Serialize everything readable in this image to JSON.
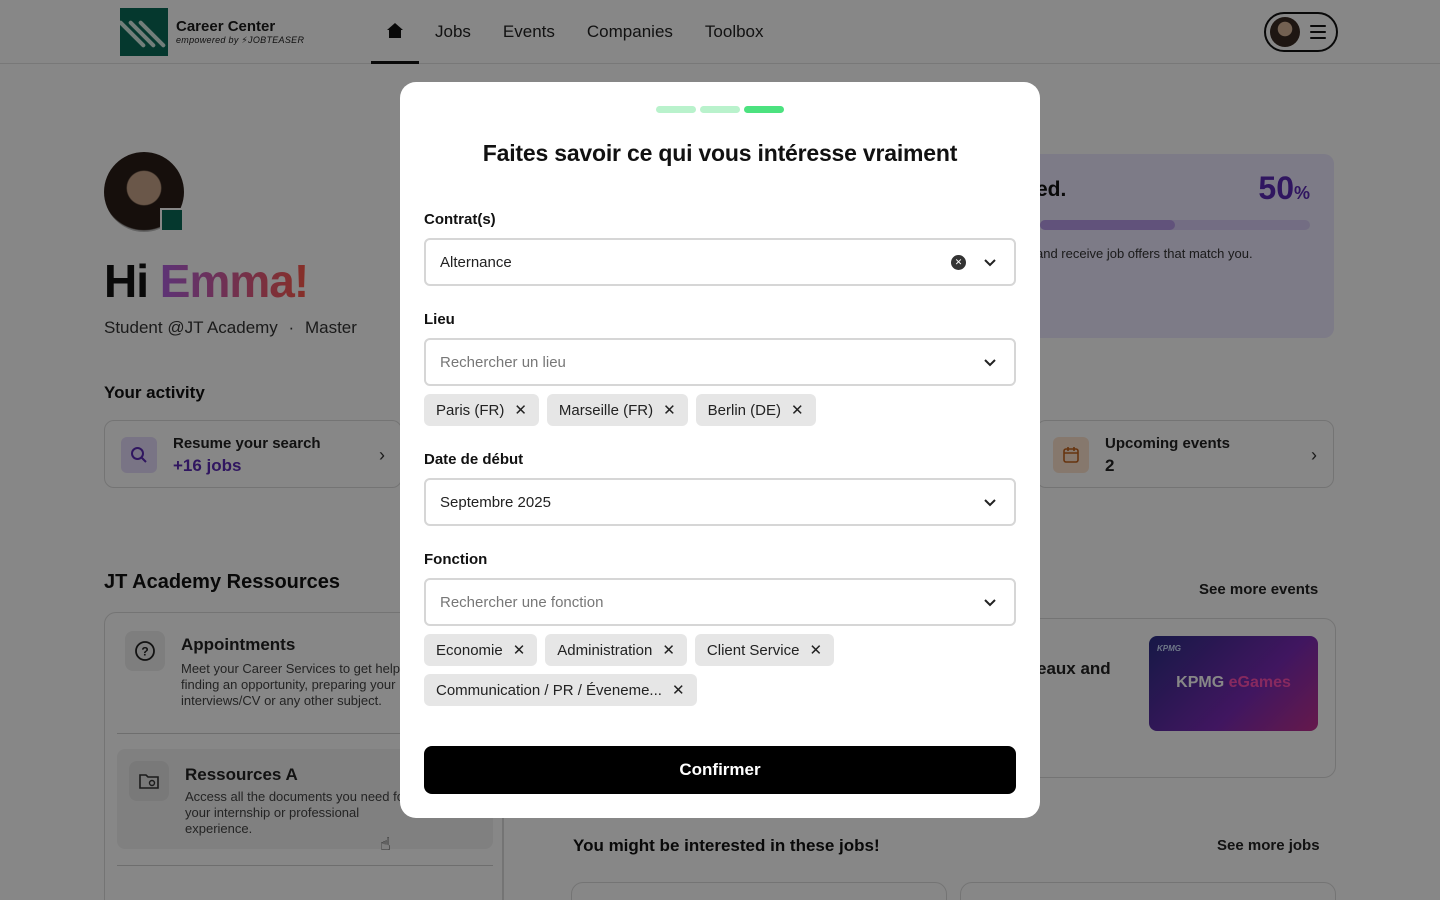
{
  "header": {
    "logo_title": "Career Center",
    "logo_sub": "empowered by ⚡JOBTEASER",
    "nav": [
      "Jobs",
      "Events",
      "Companies",
      "Toolbox"
    ]
  },
  "profile": {
    "greeting_hi": "Hi",
    "greeting_name": "Emma!",
    "school": "Student @JT Academy",
    "separator": "·",
    "level": "Master"
  },
  "activity": {
    "title": "Your activity",
    "resume_title": "Resume your search",
    "resume_value": "+16 jobs",
    "events_title": "Upcoming events",
    "events_value": "2"
  },
  "progress_card": {
    "heading_tail": "ed.",
    "percent": "50",
    "percent_sign": "%",
    "percent_value": 0.5,
    "text": "and receive job offers that match you."
  },
  "resources": {
    "title": "JT Academy Ressources",
    "items": [
      {
        "title": "Appointments",
        "desc": "Meet your Career Services to get help finding an opportunity, preparing your interviews/CV or any other subject."
      },
      {
        "title": "Ressources A",
        "desc": "Access all the documents you need for your internship or professional experience."
      }
    ]
  },
  "events_section": {
    "see_more": "See more events",
    "event_title_fragment": "eaux and",
    "thumb_brand": "KPMG",
    "thumb_title_a": "KPMG ",
    "thumb_title_b": "eGames"
  },
  "jobs_section": {
    "title": "You might be interested in these jobs!",
    "see_more": "See more jobs"
  },
  "modal": {
    "title": "Faites savoir ce qui vous intéresse vraiment",
    "steps_total": 3,
    "steps_active": 3,
    "contract": {
      "label": "Contrat(s)",
      "value": "Alternance"
    },
    "location": {
      "label": "Lieu",
      "placeholder": "Rechercher un lieu",
      "chips": [
        "Paris (FR)",
        "Marseille (FR)",
        "Berlin (DE)"
      ]
    },
    "start_date": {
      "label": "Date de début",
      "value": "Septembre 2025"
    },
    "function": {
      "label": "Fonction",
      "placeholder": "Rechercher une fonction",
      "chips": [
        "Economie",
        "Administration",
        "Client Service",
        "Communication / PR / Éveneme..."
      ]
    },
    "confirm_label": "Confirmer"
  },
  "icons": {
    "home": "home-icon",
    "menu": "hamburger-icon",
    "search": "search-icon",
    "calendar": "calendar-icon",
    "chevron": "chevron-down-icon",
    "clear": "clear-circle-icon",
    "remove": "close-icon"
  },
  "colors": {
    "brand_green": "#0b6b57",
    "step_active": "#4ce27f",
    "step_inactive": "#b9f2cc",
    "accent_purple": "#5b2bb5",
    "primary_button": "#000000"
  }
}
